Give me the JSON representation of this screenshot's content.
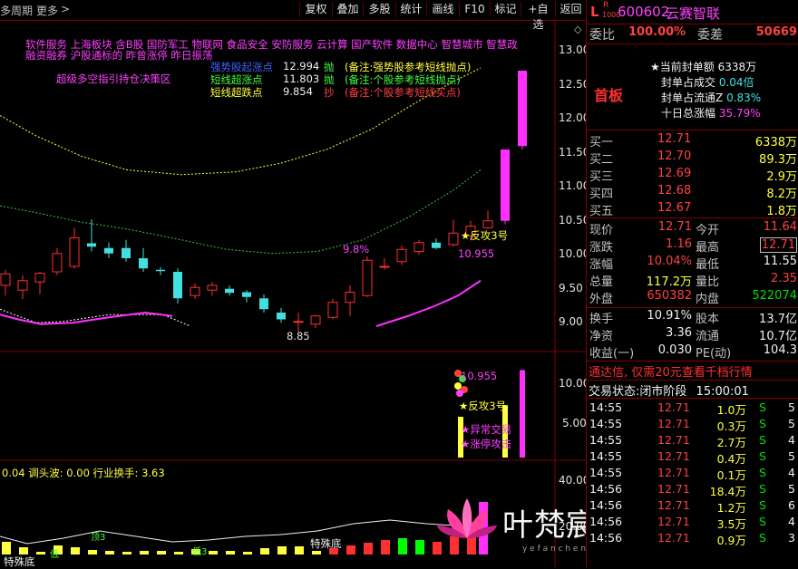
{
  "toolbar": {
    "period_label": "多周期",
    "more_label": "更多",
    "more_arrow": ">",
    "buttons": [
      "复权",
      "叠加",
      "多股",
      "统计",
      "画线",
      "F10",
      "标记",
      "+自选",
      "返回"
    ]
  },
  "chart": {
    "price_axis": [
      "13.00",
      "12.50",
      "12.00",
      "11.50",
      "11.00",
      "10.50",
      "10.00",
      "9.50",
      "9.00"
    ],
    "vol_axis": [
      "10.00",
      "5.00"
    ],
    "ind_axis": [
      "40.00",
      "20.00"
    ],
    "concepts_line1": "软件服务  上海板块  含B股 国防军工 物联网 食品安全 安防服务 云计算 国产软件 数据中心 智慧城市 智慧政",
    "concepts_line2": "融资融券 沪股通标的 昨曾涨停 昨日振荡",
    "strategy_label": "超级多空指引持仓决策区",
    "signals": [
      {
        "name": "强势股起涨点",
        "value": "12.994",
        "action": "抛",
        "note": "(备注:强势股参考短线抛点)",
        "color": "#4060ff"
      },
      {
        "name": "短线超涨点",
        "value": "11.803",
        "action": "抛",
        "note": "(备注:个股参考短线抛点)",
        "color": "#40ff40"
      },
      {
        "name": "短线超跌点",
        "value": "9.854",
        "action": "抄",
        "note": "(备注:个股参考短线买点)",
        "color": "#ffff40"
      }
    ],
    "annotations": {
      "low": "8.85",
      "pct": "9.8%",
      "counter1": "反攻3号",
      "price_mark": "10.955",
      "counter2": "反攻3号",
      "vol_mark": "10.955",
      "abnormal": "异常交易",
      "limit_up": "涨停攻击",
      "bottom1": "特殊底",
      "bottom2": "特殊底",
      "top3": "顶3",
      "dip3": "低3",
      "low_tag": "低"
    },
    "indicator_label": "0.04  调头波: 0.00  行业换手: 3.63",
    "watermark": "叶梵宸指标公式网",
    "watermark_sub": "y e f a n c h e n . c o m     指 标 公 式 网"
  },
  "quote": {
    "code": "600602",
    "name": "云赛智联",
    "prefix_l": "L",
    "prefix_r": "R",
    "prefix_num": "1000",
    "weibi_label": "委比",
    "weibi": "100.00%",
    "weicha_label": "委差",
    "weicha": "50669",
    "shouban": "首板",
    "seal_info": [
      {
        "label": "当前封单额",
        "value": "6338万"
      },
      {
        "label": "封单占成交",
        "value": "0.04倍"
      },
      {
        "label": "封单占流通Z",
        "value": "0.83%"
      },
      {
        "label": "十日总涨幅",
        "value": "35.79%"
      }
    ],
    "bids": [
      {
        "label": "买一",
        "price": "12.71",
        "vol": "6338万"
      },
      {
        "label": "买二",
        "price": "12.70",
        "vol": "89.3万"
      },
      {
        "label": "买三",
        "price": "12.69",
        "vol": "2.9万"
      },
      {
        "label": "买四",
        "price": "12.68",
        "vol": "8.2万"
      },
      {
        "label": "买五",
        "price": "12.67",
        "vol": "1.8万"
      }
    ],
    "stats": [
      {
        "l1": "现价",
        "v1": "12.71",
        "c1": "red",
        "l2": "今开",
        "v2": "11.64",
        "c2": "red"
      },
      {
        "l1": "涨跌",
        "v1": "1.16",
        "c1": "red",
        "l2": "最高",
        "v2": "12.71",
        "c2": "red"
      },
      {
        "l1": "涨幅",
        "v1": "10.04%",
        "c1": "red",
        "l2": "最低",
        "v2": "11.55",
        "c2": "white"
      },
      {
        "l1": "总量",
        "v1": "117.2万",
        "c1": "yellow",
        "l2": "量比",
        "v2": "2.35",
        "c2": "red"
      },
      {
        "l1": "外盘",
        "v1": "650382",
        "c1": "red",
        "l2": "内盘",
        "v2": "522074",
        "c2": "green"
      }
    ],
    "fund": [
      {
        "l1": "换手",
        "v1": "10.91%",
        "l2": "股本",
        "v2": "13.7亿"
      },
      {
        "l1": "净资",
        "v1": "3.36",
        "l2": "流通",
        "v2": "10.7亿"
      },
      {
        "l1": "收益(一)",
        "v1": "0.030",
        "l2": "PE(动)",
        "v2": "104.3"
      }
    ],
    "promo": "通达信, 仅需20元查看千档行情",
    "trade_status_label": "交易状态:",
    "trade_status": "闭市阶段",
    "trade_time": "15:00:01",
    "ticks": [
      {
        "t": "14:55",
        "p": "12.71",
        "v": "1.0万",
        "s": "S",
        "n": "5"
      },
      {
        "t": "14:55",
        "p": "12.71",
        "v": "0.3万",
        "s": "S",
        "n": "5"
      },
      {
        "t": "14:55",
        "p": "12.71",
        "v": "2.7万",
        "s": "S",
        "n": "4"
      },
      {
        "t": "14:55",
        "p": "12.71",
        "v": "0.4万",
        "s": "S",
        "n": "5"
      },
      {
        "t": "14:55",
        "p": "12.71",
        "v": "0.1万",
        "s": "S",
        "n": "4"
      },
      {
        "t": "14:56",
        "p": "12.71",
        "v": "18.4万",
        "s": "S",
        "n": "5"
      },
      {
        "t": "14:56",
        "p": "12.71",
        "v": "1.2万",
        "s": "S",
        "n": "6"
      },
      {
        "t": "14:56",
        "p": "12.71",
        "v": "3.5万",
        "s": "S",
        "n": "4"
      },
      {
        "t": "14:56",
        "p": "12.71",
        "v": "0.9万",
        "s": "S",
        "n": "3"
      }
    ]
  },
  "chart_data": {
    "type": "candlestick",
    "candles": [
      {
        "o": 9.55,
        "h": 9.78,
        "l": 9.4,
        "c": 9.72
      },
      {
        "o": 9.48,
        "h": 9.7,
        "l": 9.35,
        "c": 9.62
      },
      {
        "o": 9.6,
        "h": 9.75,
        "l": 9.42,
        "c": 9.73
      },
      {
        "o": 9.75,
        "h": 10.1,
        "l": 9.7,
        "c": 10.02
      },
      {
        "o": 9.83,
        "h": 10.4,
        "l": 9.8,
        "c": 10.25
      },
      {
        "o": 10.17,
        "h": 10.52,
        "l": 10.05,
        "c": 10.12
      },
      {
        "o": 10.1,
        "h": 10.18,
        "l": 9.95,
        "c": 10.02
      },
      {
        "o": 10.1,
        "h": 10.22,
        "l": 9.9,
        "c": 9.95
      },
      {
        "o": 9.95,
        "h": 10.1,
        "l": 9.75,
        "c": 9.8
      },
      {
        "o": 9.78,
        "h": 9.82,
        "l": 9.7,
        "c": 9.76
      },
      {
        "o": 9.75,
        "h": 9.8,
        "l": 9.28,
        "c": 9.36
      },
      {
        "o": 9.4,
        "h": 9.58,
        "l": 9.35,
        "c": 9.52
      },
      {
        "o": 9.48,
        "h": 9.6,
        "l": 9.4,
        "c": 9.55
      },
      {
        "o": 9.5,
        "h": 9.55,
        "l": 9.4,
        "c": 9.44
      },
      {
        "o": 9.45,
        "h": 9.48,
        "l": 9.3,
        "c": 9.38
      },
      {
        "o": 9.36,
        "h": 9.42,
        "l": 9.15,
        "c": 9.2
      },
      {
        "o": 9.15,
        "h": 9.22,
        "l": 9.0,
        "c": 9.05
      },
      {
        "o": 9.02,
        "h": 9.15,
        "l": 8.85,
        "c": 9.02
      },
      {
        "o": 8.98,
        "h": 9.12,
        "l": 8.92,
        "c": 9.1
      },
      {
        "o": 9.08,
        "h": 9.35,
        "l": 9.05,
        "c": 9.3
      },
      {
        "o": 9.3,
        "h": 9.55,
        "l": 9.1,
        "c": 9.45
      },
      {
        "o": 9.4,
        "h": 9.98,
        "l": 9.38,
        "c": 9.92
      },
      {
        "o": 9.82,
        "h": 9.95,
        "l": 9.78,
        "c": 9.83
      },
      {
        "o": 9.9,
        "h": 10.14,
        "l": 9.85,
        "c": 10.08
      },
      {
        "o": 10.05,
        "h": 10.22,
        "l": 10.0,
        "c": 10.18
      },
      {
        "o": 10.18,
        "h": 10.24,
        "l": 10.08,
        "c": 10.1
      },
      {
        "o": 10.15,
        "h": 10.52,
        "l": 10.12,
        "c": 10.32
      },
      {
        "o": 10.28,
        "h": 10.5,
        "l": 10.22,
        "c": 10.42
      },
      {
        "o": 10.4,
        "h": 10.65,
        "l": 10.38,
        "c": 10.5
      },
      {
        "o": 10.5,
        "h": 11.55,
        "l": 10.45,
        "c": 11.55
      },
      {
        "o": 11.6,
        "h": 12.71,
        "l": 11.55,
        "c": 12.71
      }
    ],
    "ylim": [
      8.75,
      13.15
    ]
  }
}
